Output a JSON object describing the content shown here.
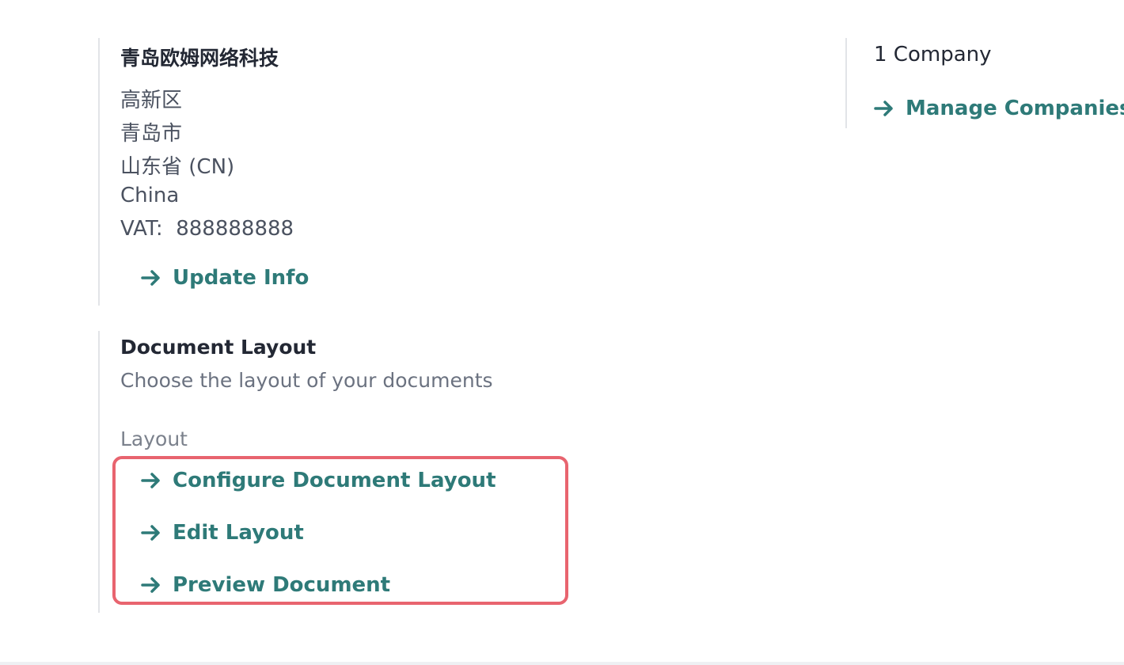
{
  "company": {
    "name": "青岛欧姆网络科技",
    "address_lines": [
      "高新区",
      "青岛市",
      "山东省 (CN)",
      "China"
    ],
    "vat_label": "VAT:",
    "vat_value": "888888888",
    "update_link": "Update Info"
  },
  "companies": {
    "count_label": "1 Company",
    "manage_link": "Manage Companies"
  },
  "document_layout": {
    "title": "Document Layout",
    "description": "Choose the layout of your documents",
    "field_label": "Layout",
    "links": [
      "Configure Document Layout",
      "Edit Layout",
      "Preview Document"
    ]
  },
  "colors": {
    "link": "#2e7a78",
    "highlight": "#e8646f",
    "title": "#232834",
    "text": "#4b5260",
    "divider": "#e2e4e8"
  },
  "icons": {
    "link_arrow": "arrow-right-icon"
  }
}
